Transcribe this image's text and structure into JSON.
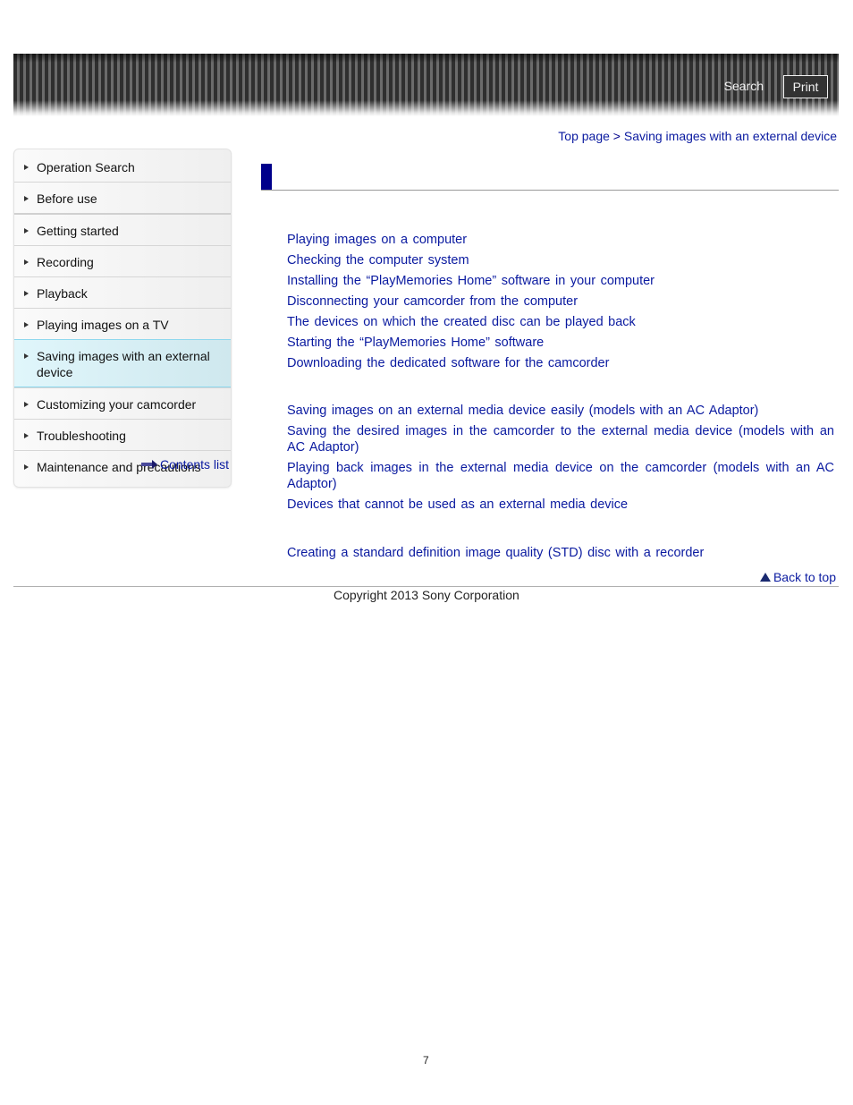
{
  "header": {
    "search_label": "Search",
    "print_label": "Print"
  },
  "breadcrumb": {
    "top_page": "Top page",
    "separator": ">",
    "current": "Saving images with an external device"
  },
  "sidebar": {
    "items": [
      {
        "label": "Operation Search"
      },
      {
        "label": "Before use"
      },
      {
        "label": "Getting started"
      },
      {
        "label": "Recording"
      },
      {
        "label": "Playback"
      },
      {
        "label": "Playing images on a TV"
      },
      {
        "label": "Saving images with an external device",
        "active": true
      },
      {
        "label": "Customizing your camcorder"
      },
      {
        "label": "Troubleshooting"
      },
      {
        "label": "Maintenance and precautions"
      }
    ],
    "contents_list_label": "Contents list"
  },
  "main": {
    "heading": "",
    "groups": [
      {
        "links": [
          "Playing images on a computer",
          "Checking the computer system",
          "Installing the “PlayMemories Home” software in your computer",
          "Disconnecting your camcorder from the computer",
          "The devices on which the created disc can be played back",
          "Starting the “PlayMemories Home” software",
          "Downloading the dedicated software for the camcorder"
        ]
      },
      {
        "links": [
          "Saving images on an external media device easily (models with an AC Adaptor)",
          "Saving the desired images in the camcorder to the external media device (models with an AC Adaptor)",
          "Playing back images in the external media device on the camcorder (models with an AC Adaptor)",
          "Devices that cannot be used as an external media device"
        ]
      },
      {
        "links": [
          "Creating a standard definition image quality (STD) disc with a recorder"
        ]
      }
    ]
  },
  "footer": {
    "back_to_top": "Back to top",
    "copyright": "Copyright 2013 Sony Corporation",
    "page_number": "7"
  },
  "colors": {
    "link": "#0a1aa0",
    "heading_bar": "#00008b",
    "active_item_bg": "#d8f0f5"
  }
}
